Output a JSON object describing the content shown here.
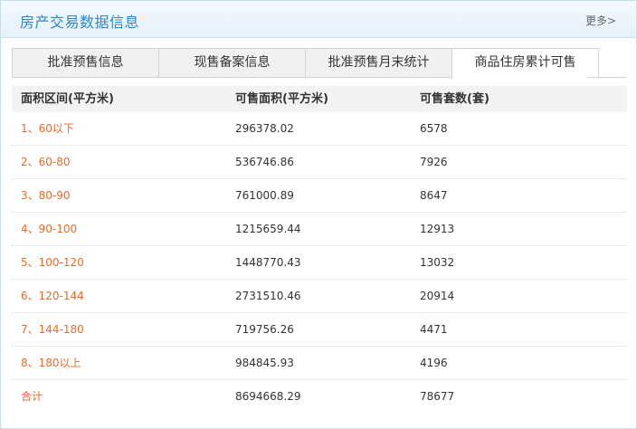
{
  "header": {
    "title": "房产交易数据信息",
    "more_label": "更多>"
  },
  "tabs": [
    {
      "label": "批准预售信息",
      "active": false
    },
    {
      "label": "现售备案信息",
      "active": false
    },
    {
      "label": "批准预售月末统计",
      "active": false
    },
    {
      "label": "商品住房累计可售",
      "active": true
    }
  ],
  "table": {
    "columns": [
      "面积区间(平方米)",
      "可售面积(平方米)",
      "可售套数(套)"
    ],
    "rows": [
      [
        "1、60以下",
        "296378.02",
        "6578"
      ],
      [
        "2、60-80",
        "536746.86",
        "7926"
      ],
      [
        "3、80-90",
        "761000.89",
        "8647"
      ],
      [
        "4、90-100",
        "1215659.44",
        "12913"
      ],
      [
        "5、100-120",
        "1448770.43",
        "13032"
      ],
      [
        "6、120-144",
        "2731510.46",
        "20914"
      ],
      [
        "7、144-180",
        "719756.26",
        "4471"
      ],
      [
        "8、180以上",
        "984845.93",
        "4196"
      ],
      [
        "合计",
        "8694668.29",
        "78677"
      ]
    ]
  },
  "colors": {
    "title": "#2f86c7",
    "range_text": "#e46d2b",
    "border": "#c9dcea"
  }
}
